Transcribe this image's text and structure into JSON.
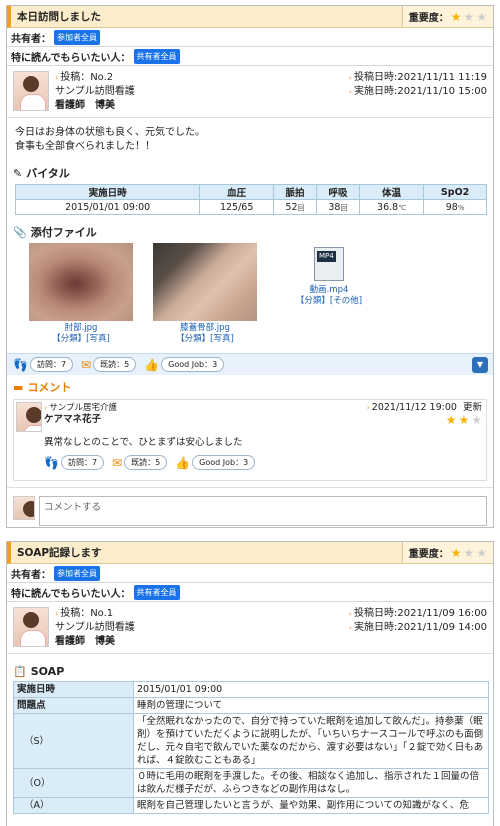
{
  "post1": {
    "title": "本日訪問しました",
    "importance_label": "重要度：",
    "importance_stars": 1,
    "sharer_label": "共有者：",
    "sharer_badge": "参加者全員",
    "must_read_label": "特に読んでもらいたい人：",
    "must_read_badge": "共有者全員",
    "post_no": "投稿：No.2",
    "org": "サンプル訪問看護",
    "author": "看護師　博美",
    "post_date": "投稿日時:2021/11/11 11:19",
    "done_date": "実施日時:2021/11/10 15:00",
    "body_line1": "今日はお身体の状態も良く、元気でした。",
    "body_line2": "食事も全部食べられました！！",
    "vital_title": "バイタル",
    "vital_headers": [
      "実施日時",
      "血圧",
      "脈拍",
      "呼吸",
      "体温",
      "SpO2"
    ],
    "vital_row": {
      "date": "2015/01/01 09:00",
      "bp": "125/65",
      "pulse": "52",
      "pulse_unit": "回",
      "resp": "38",
      "resp_unit": "回",
      "temp": "36.8",
      "temp_unit": "℃",
      "spo2": "98",
      "spo2_unit": "%"
    },
    "attach_title": "添付ファイル",
    "attachments": [
      {
        "name": "肘部.jpg",
        "meta": "【分類】[写真]"
      },
      {
        "name": "膝蓋骨部.jpg",
        "meta": "【分類】[写真]"
      },
      {
        "name": "動画.mp4",
        "meta": "【分類】[その他]",
        "badge": "MP4"
      }
    ],
    "visits": "訪問：7",
    "read": "既読：5",
    "goodjob": "Good Job：3",
    "comment_title": "コメント",
    "comment": {
      "org": "サンプル居宅介護",
      "author": "ケアマネ花子",
      "date": "2021/11/12 19:00",
      "update": "更新",
      "stars": 2,
      "text": "異常なしとのことで、ひとまずは安心しました",
      "visits": "訪問：7",
      "read": "既読：5",
      "goodjob": "Good Job：3"
    },
    "comment_placeholder": "コメントする"
  },
  "post2": {
    "title": "SOAP記録します",
    "importance_label": "重要度：",
    "importance_stars": 1,
    "sharer_label": "共有者：",
    "sharer_badge": "参加者全員",
    "must_read_label": "特に読んでもらいたい人：",
    "must_read_badge": "共有者全員",
    "post_no": "投稿：No.1",
    "org": "サンプル訪問看護",
    "author": "看護師　博美",
    "post_date": "投稿日時:2021/11/09 16:00",
    "done_date": "実施日時:2021/11/09 14:00",
    "soap_title": "SOAP",
    "soap_rows": [
      {
        "label": "実施日時",
        "value": "2015/01/01 09:00"
      },
      {
        "label": "問題点",
        "value": "睡剤の管理について"
      },
      {
        "label": "（S）",
        "value": "「全然眠れなかったので、自分で持っていた眠剤を追加して飲んだ」。持参薬（眠剤）を預けていただくように説明したが、「いちいちナースコールで呼ぶのも面倒だし、元々自宅で飲んでいた薬なのだから、渡す必要はない」「２錠で効く日もあれば、４錠飲むこともある」"
      },
      {
        "label": "（O）",
        "value": "０時に毛用の眠剤を手渡した。その後、相談なく追加し、指示された１回量の倍は飲んだ様子だが、ふらつきなどの副作用はなし。"
      },
      {
        "label": "（A）",
        "value": "眠剤を自己管理したいと言うが、量や効果、副作用についての知識がなく、危"
      }
    ]
  }
}
